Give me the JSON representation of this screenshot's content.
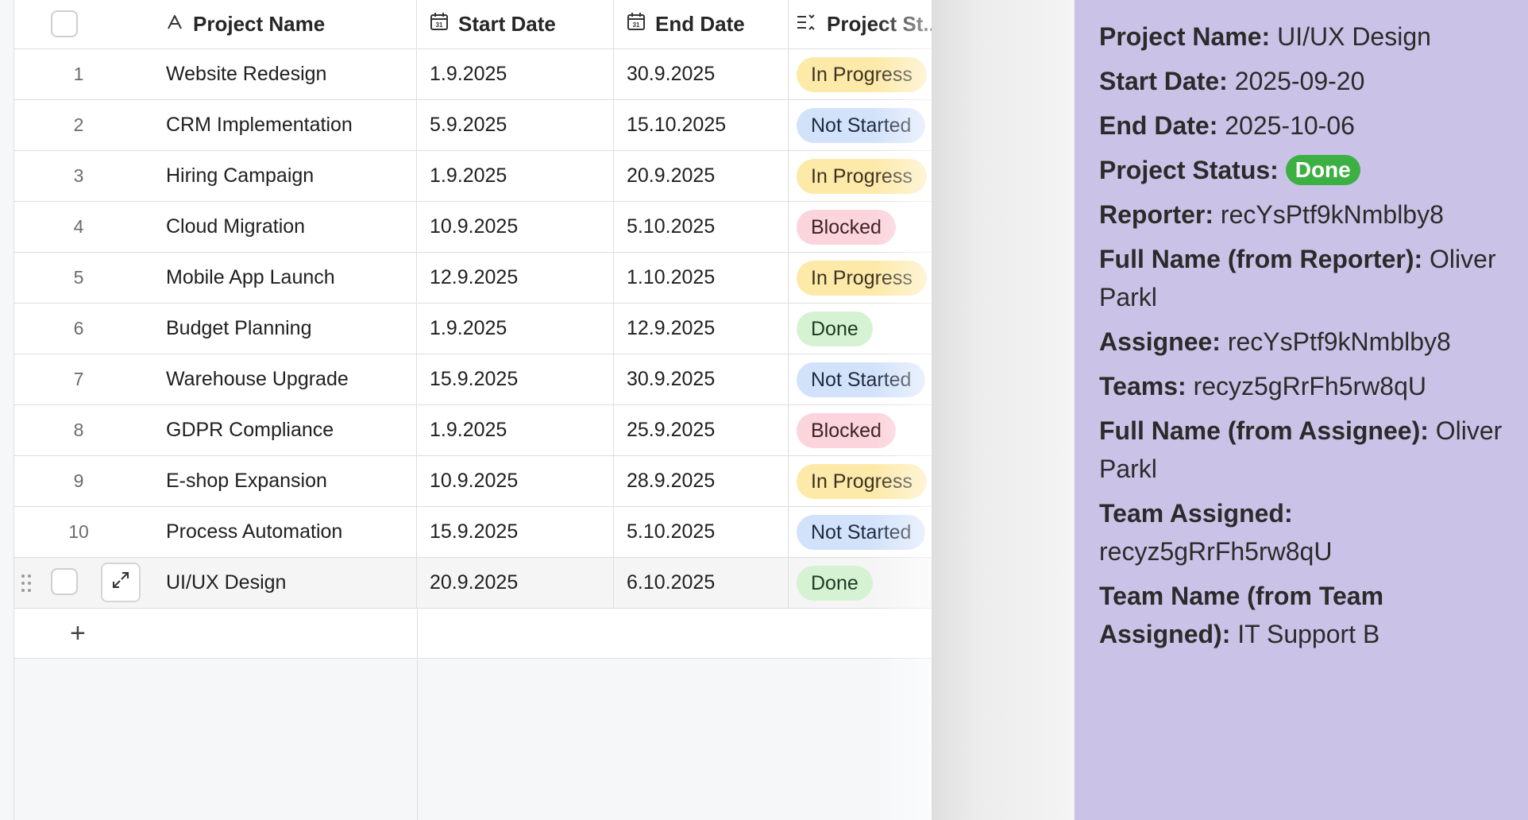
{
  "columns": {
    "name": "Project Name",
    "start": "Start Date",
    "end": "End Date",
    "status": "Project St..."
  },
  "status_colors": {
    "In Progress": "#fde9a8",
    "Not Started": "#d3e2fb",
    "Blocked": "#fbd4dc",
    "Done": "#d5f3d3"
  },
  "rows": [
    {
      "idx": "1",
      "name": "Website Redesign",
      "start": "1.9.2025",
      "end": "30.9.2025",
      "status": "In Progress"
    },
    {
      "idx": "2",
      "name": "CRM Implementation",
      "start": "5.9.2025",
      "end": "15.10.2025",
      "status": "Not Started"
    },
    {
      "idx": "3",
      "name": "Hiring Campaign",
      "start": "1.9.2025",
      "end": "20.9.2025",
      "status": "In Progress"
    },
    {
      "idx": "4",
      "name": "Cloud Migration",
      "start": "10.9.2025",
      "end": "5.10.2025",
      "status": "Blocked"
    },
    {
      "idx": "5",
      "name": "Mobile App Launch",
      "start": "12.9.2025",
      "end": "1.10.2025",
      "status": "In Progress"
    },
    {
      "idx": "6",
      "name": "Budget Planning",
      "start": "1.9.2025",
      "end": "12.9.2025",
      "status": "Done"
    },
    {
      "idx": "7",
      "name": "Warehouse Upgrade",
      "start": "15.9.2025",
      "end": "30.9.2025",
      "status": "Not Started"
    },
    {
      "idx": "8",
      "name": "GDPR Compliance",
      "start": "1.9.2025",
      "end": "25.9.2025",
      "status": "Blocked"
    },
    {
      "idx": "9",
      "name": "E-shop Expansion",
      "start": "10.9.2025",
      "end": "28.9.2025",
      "status": "In Progress"
    },
    {
      "idx": "10",
      "name": "Process Automation",
      "start": "15.9.2025",
      "end": "5.10.2025",
      "status": "Not Started"
    },
    {
      "idx": "",
      "name": "UI/UX Design",
      "start": "20.9.2025",
      "end": "6.10.2025",
      "status": "Done"
    }
  ],
  "add_row_symbol": "+",
  "detail": {
    "project_name_label": "Project Name:",
    "project_name_value": "UI/UX Design",
    "start_label": "Start Date:",
    "start_value": "2025-09-20",
    "end_label": "End Date:",
    "end_value": "2025-10-06",
    "status_label": "Project Status:",
    "status_value": "Done",
    "status_color": "#3cb043",
    "reporter_label": "Reporter:",
    "reporter_value": "recYsPtf9kNmblby8",
    "fullname_reporter_label": "Full Name (from Reporter):",
    "fullname_reporter_value": "Oliver Parkl",
    "assignee_label": "Assignee:",
    "assignee_value": "recYsPtf9kNmblby8",
    "teams_label": "Teams:",
    "teams_value": "recyz5gRrFh5rw8qU",
    "fullname_assignee_label": "Full Name (from Assignee):",
    "fullname_assignee_value": "Oliver Parkl",
    "team_assigned_label": "Team Assigned:",
    "team_assigned_value": "recyz5gRrFh5rw8qU",
    "team_name_label": "Team Name (from Team Assigned):",
    "team_name_value": "IT Support B"
  }
}
